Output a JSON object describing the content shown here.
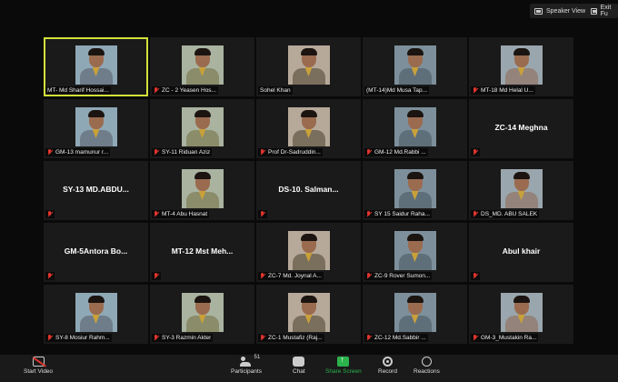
{
  "top": {
    "speaker_view": "Speaker View",
    "exit_full": "Exit Fu"
  },
  "tiles": [
    {
      "name": "MT- Md Sharif Hossai...",
      "video": true,
      "muted": false,
      "active": true
    },
    {
      "name": "ZC - 2 Yeasen Hos...",
      "video": true,
      "muted": true
    },
    {
      "name": "Sohel Khan",
      "video": true,
      "muted": false
    },
    {
      "name": "(MT-14)Md Musa Tap...",
      "video": true,
      "muted": false
    },
    {
      "name": "MT-18 Md Helal U...",
      "video": true,
      "muted": true
    },
    {
      "name": "GM-13 mamunur r...",
      "video": true,
      "muted": true
    },
    {
      "name": "SY-11 Riduan Aziz",
      "video": true,
      "muted": true
    },
    {
      "name": "Prof Dr-Sadruddin...",
      "video": true,
      "muted": true
    },
    {
      "name": "GM-12 Md.Rabbi ...",
      "video": true,
      "muted": true
    },
    {
      "name": "",
      "big": "ZC-14 Meghna",
      "video": false,
      "muted": true
    },
    {
      "name": "",
      "big": "SY-13 MD.ABDU...",
      "video": false,
      "muted": true
    },
    {
      "name": "MT-4 Abu Hasnat",
      "video": true,
      "muted": true
    },
    {
      "name": "",
      "big": "DS-10. Salman...",
      "video": false,
      "muted": true
    },
    {
      "name": "SY 15 Saidur Raha...",
      "video": true,
      "muted": true
    },
    {
      "name": "DS_MD. ABU SALEK",
      "video": true,
      "muted": true
    },
    {
      "name": "",
      "big": "GM-5Antora Bo...",
      "video": false,
      "muted": true
    },
    {
      "name": "",
      "big": "MT-12 Mst Meh...",
      "video": false,
      "muted": true
    },
    {
      "name": "ZC-7 Md. Joynal A...",
      "video": true,
      "muted": true
    },
    {
      "name": "ZC-9 Rover Sumon...",
      "video": true,
      "muted": true
    },
    {
      "name": "",
      "big": "Abul khair",
      "video": false,
      "muted": true
    },
    {
      "name": "SY-8 Mosiur Rahm...",
      "video": true,
      "muted": true
    },
    {
      "name": "SY-3 Razmin Akter",
      "video": true,
      "muted": true
    },
    {
      "name": "ZC-1 Mustafiz (Raj...",
      "video": true,
      "muted": true
    },
    {
      "name": "ZC-12 Md.Sabbir ...",
      "video": true,
      "muted": true
    },
    {
      "name": "GM-3_Mustakin Ra...",
      "video": true,
      "muted": true
    }
  ],
  "toolbar": {
    "start_video": "Start Video",
    "participants": "Participants",
    "participants_count": "51",
    "chat": "Chat",
    "share_screen": "Share Screen",
    "record": "Record",
    "reactions": "Reactions"
  },
  "colors": {
    "active_border": "#d4e13a",
    "muted": "#e0352e",
    "share": "#2bb24c"
  }
}
